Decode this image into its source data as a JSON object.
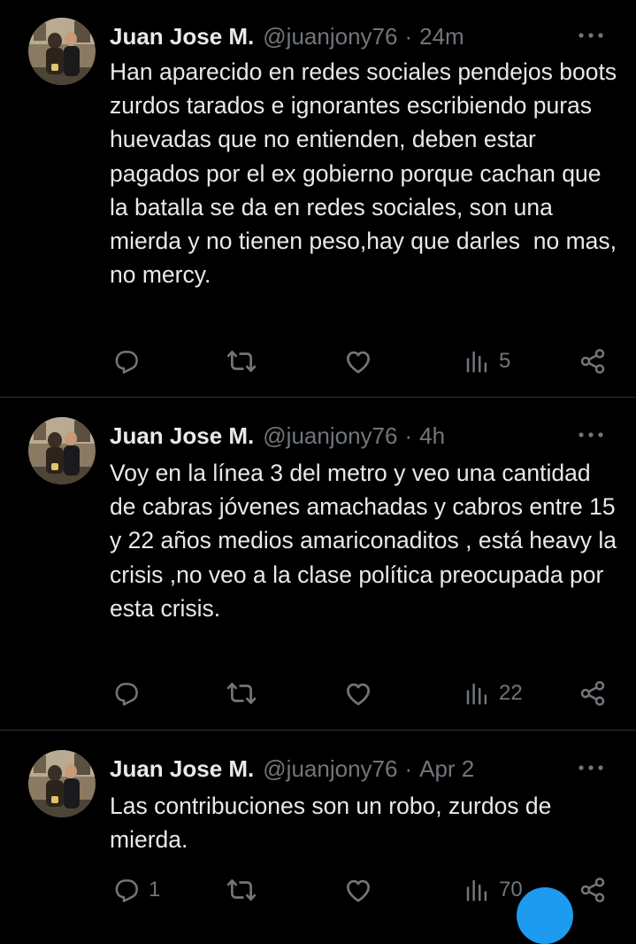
{
  "colors": {
    "background": "#000000",
    "text_primary": "#e7e9ea",
    "text_secondary": "#71767b",
    "divider": "#2f3336",
    "accent": "#1d9bf0"
  },
  "icons": {
    "more": "more-horizontal-icon",
    "reply": "reply-icon",
    "retweet": "retweet-icon",
    "like": "heart-icon",
    "views": "views-chart-icon",
    "share": "share-icon"
  },
  "tweets": [
    {
      "author": "Juan Jose M.",
      "handle": "@juanjony76",
      "separator": "·",
      "time": "24m",
      "text": "Han aparecido en redes sociales pendejos boots zurdos tarados e ignorantes escribiendo puras huevadas que no entienden, deben estar pagados por el ex gobierno porque cachan que la batalla se da en redes sociales, son una mierda y no tienen peso,hay que darles  no mas, no mercy.",
      "replies": "",
      "retweets": "",
      "likes": "",
      "views": "5"
    },
    {
      "author": "Juan Jose M.",
      "handle": "@juanjony76",
      "separator": "·",
      "time": "4h",
      "text": "Voy en la línea 3 del metro y veo una cantidad de cabras jóvenes amachadas y cabros entre 15 y 22 años medios amariconaditos , está heavy la crisis ,no veo a la clase política preocupada por esta crisis.",
      "replies": "",
      "retweets": "",
      "likes": "",
      "views": "22"
    },
    {
      "author": "Juan Jose M.",
      "handle": "@juanjony76",
      "separator": "·",
      "time": "Apr 2",
      "text": "Las contribuciones son un robo, zurdos de mierda.",
      "replies": "1",
      "retweets": "",
      "likes": "",
      "views": "70"
    }
  ]
}
